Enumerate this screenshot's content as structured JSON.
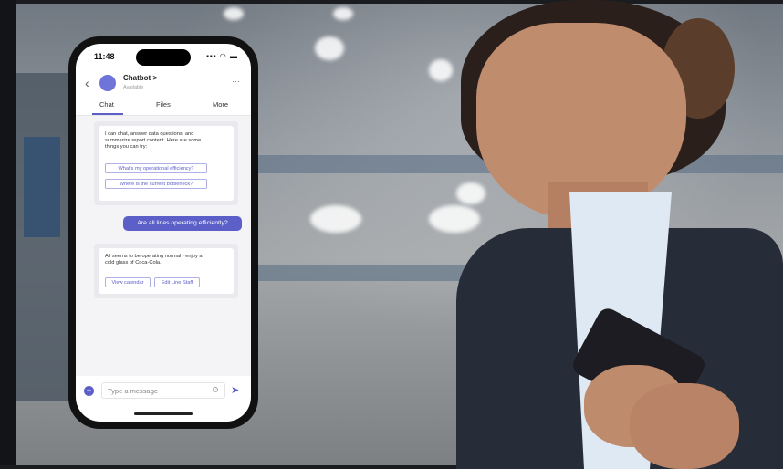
{
  "phone": {
    "time": "11:48",
    "status_icons": "▪▪▪ ◠ ▬"
  },
  "header": {
    "back_icon": "‹",
    "bot_name": "Chatbot >",
    "bot_status": "Available",
    "more_icon": "···"
  },
  "tabs": [
    {
      "label": "Chat",
      "active": true
    },
    {
      "label": "Files",
      "active": false
    },
    {
      "label": "More",
      "active": false
    }
  ],
  "messages": {
    "bot_intro_lines": [
      "I can chat, answer data questions, and",
      "summarize report content. Here are some",
      "things you can try:"
    ],
    "suggestions": [
      "What's my operational efficiency?",
      "Where is the current bottleneck?"
    ],
    "user_message": "Are all lines operating efficiently?",
    "bot_reply_lines": [
      "All seems to be operating normal - enjoy a",
      "cold glass of Coca-Cola."
    ],
    "reply_actions": [
      "View calendar",
      "Edit Line Staff"
    ]
  },
  "compose": {
    "placeholder": "Type a message",
    "plus_icon": "+",
    "emoji_icon": "☺",
    "send_icon": "➤"
  },
  "colors": {
    "accent": "#5b5fc7",
    "jacket": "#272d38",
    "shirt": "#dfe9f4"
  }
}
